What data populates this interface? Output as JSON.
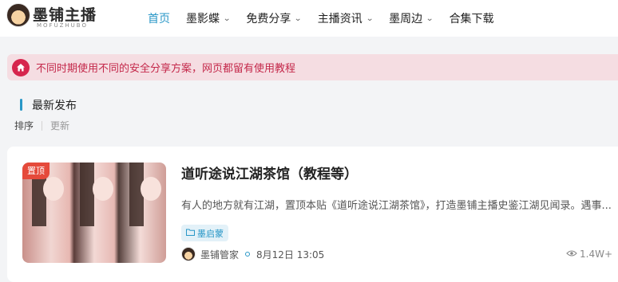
{
  "header": {
    "logo_title": "墨铺主播",
    "logo_sub": "MOFUZHUBO",
    "nav": [
      {
        "label": "首页",
        "has_dropdown": false,
        "active": true
      },
      {
        "label": "墨影蝶",
        "has_dropdown": true,
        "active": false
      },
      {
        "label": "免费分享",
        "has_dropdown": true,
        "active": false
      },
      {
        "label": "主播资讯",
        "has_dropdown": true,
        "active": false
      },
      {
        "label": "墨周边",
        "has_dropdown": true,
        "active": false
      },
      {
        "label": "合集下载",
        "has_dropdown": false,
        "active": false
      }
    ]
  },
  "notice": {
    "icon": "home-icon",
    "text": "不同时期使用不同的安全分享方案，网页都留有使用教程"
  },
  "section": {
    "title": "最新发布",
    "sort_label": "排序",
    "sort_option": "更新"
  },
  "post": {
    "badge": "置顶",
    "title": "道听途说江湖茶馆（教程等）",
    "excerpt": "有人的地方就有江湖，置顶本贴《道听途说江湖茶馆》，打造墨铺主播史鉴江湖见闻录。遇事...",
    "tag": "墨启蒙",
    "author": "墨铺管家",
    "date": "8月12日 13:05",
    "views": "1.4W+"
  },
  "colors": {
    "accent": "#2997c7",
    "notice_bg": "#f5dde2",
    "notice_text": "#c4284a",
    "badge": "#e54a3b"
  }
}
